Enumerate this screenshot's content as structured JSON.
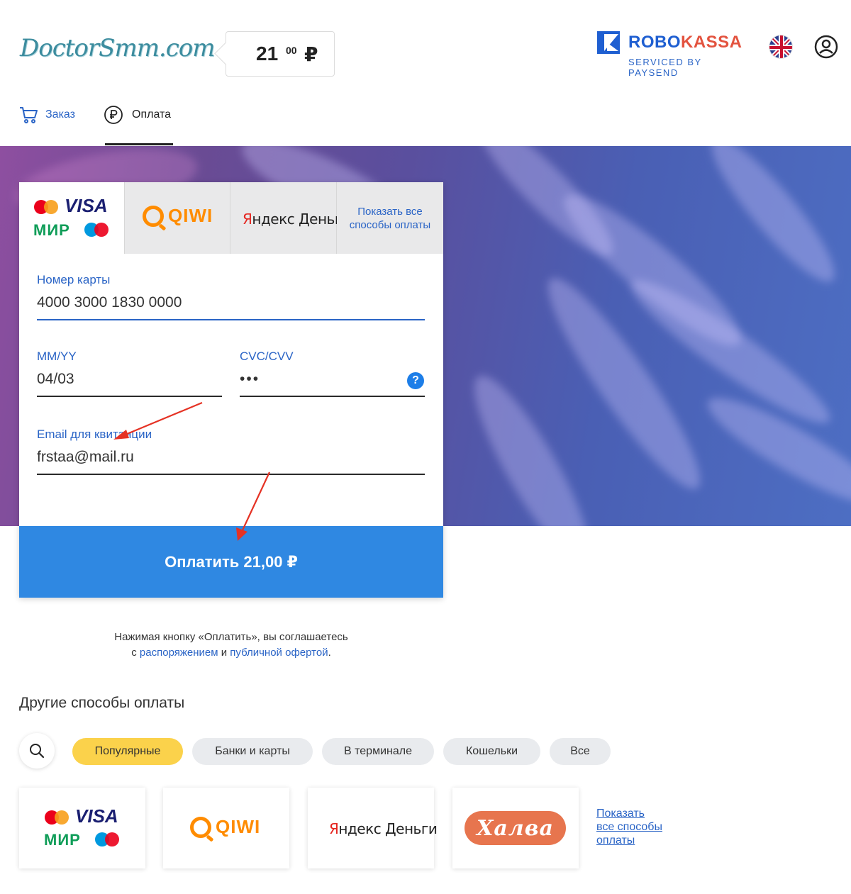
{
  "header": {
    "merchant_logo": "DoctorSmm.com",
    "amount_main": "21",
    "amount_cents": "00",
    "amount_currency": "₽",
    "provider_name_part1": "ROBO",
    "provider_name_part2": "KASSA",
    "provider_sub": "SERVICED BY PAYSEND",
    "icons": {
      "language": "uk-flag-icon",
      "user": "user-icon"
    }
  },
  "steps": {
    "order_label": "Заказ",
    "payment_label": "Оплата",
    "active": "payment"
  },
  "payment_tabs": {
    "cards": {
      "visa": "VISA",
      "mir": "МИР"
    },
    "qiwi": "QIWI",
    "yandex": {
      "ya": "Я",
      "rest": "ндекс Деньги"
    },
    "more": "Показать все способы оплаты"
  },
  "form": {
    "card_number_label": "Номер карты",
    "card_number_value": "4000 3000 1830 0000",
    "expiry_label": "MM/YY",
    "expiry_value": "04/03",
    "cvc_label": "CVC/CVV",
    "cvc_value": "•••",
    "help_symbol": "?",
    "email_label": "Email для квитанции",
    "email_value": "frstaa@mail.ru",
    "pay_button": "Оплатить 21,00 ₽"
  },
  "agreement": {
    "line1": "Нажимая кнопку «Оплатить», вы соглашаетесь",
    "prefix": "с ",
    "link1": "распоряжением",
    "middle": " и ",
    "link2": "публичной офертой",
    "suffix": "."
  },
  "other_methods": {
    "title": "Другие способы оплаты",
    "chips": [
      "Популярные",
      "Банки и карты",
      "В терминале",
      "Кошельки",
      "Все"
    ],
    "active_chip": "Популярные",
    "cards": {
      "cards_visa": "VISA",
      "cards_mir": "МИР",
      "qiwi": "QIWI",
      "yandex_ya": "Я",
      "yandex_rest": "ндекс Деньги",
      "halva": "Халва"
    },
    "show_all": "Показать\nвсе способы\nоплаты"
  },
  "colors": {
    "accent_blue": "#2f88e2",
    "link_blue": "#2a64c6",
    "chip_active": "#fbd24b",
    "annotation_arrow": "#e53224"
  }
}
